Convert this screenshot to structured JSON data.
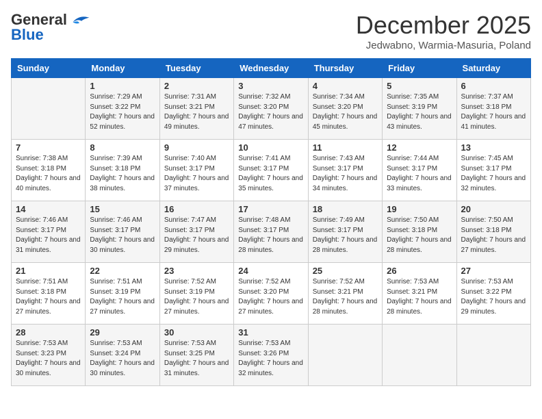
{
  "header": {
    "logo_general": "General",
    "logo_blue": "Blue",
    "month_year": "December 2025",
    "location": "Jedwabno, Warmia-Masuria, Poland"
  },
  "days_of_week": [
    "Sunday",
    "Monday",
    "Tuesday",
    "Wednesday",
    "Thursday",
    "Friday",
    "Saturday"
  ],
  "weeks": [
    [
      {
        "day": "",
        "sunrise": "",
        "sunset": "",
        "daylight": ""
      },
      {
        "day": "1",
        "sunrise": "Sunrise: 7:29 AM",
        "sunset": "Sunset: 3:22 PM",
        "daylight": "Daylight: 7 hours and 52 minutes."
      },
      {
        "day": "2",
        "sunrise": "Sunrise: 7:31 AM",
        "sunset": "Sunset: 3:21 PM",
        "daylight": "Daylight: 7 hours and 49 minutes."
      },
      {
        "day": "3",
        "sunrise": "Sunrise: 7:32 AM",
        "sunset": "Sunset: 3:20 PM",
        "daylight": "Daylight: 7 hours and 47 minutes."
      },
      {
        "day": "4",
        "sunrise": "Sunrise: 7:34 AM",
        "sunset": "Sunset: 3:20 PM",
        "daylight": "Daylight: 7 hours and 45 minutes."
      },
      {
        "day": "5",
        "sunrise": "Sunrise: 7:35 AM",
        "sunset": "Sunset: 3:19 PM",
        "daylight": "Daylight: 7 hours and 43 minutes."
      },
      {
        "day": "6",
        "sunrise": "Sunrise: 7:37 AM",
        "sunset": "Sunset: 3:18 PM",
        "daylight": "Daylight: 7 hours and 41 minutes."
      }
    ],
    [
      {
        "day": "7",
        "sunrise": "Sunrise: 7:38 AM",
        "sunset": "Sunset: 3:18 PM",
        "daylight": "Daylight: 7 hours and 40 minutes."
      },
      {
        "day": "8",
        "sunrise": "Sunrise: 7:39 AM",
        "sunset": "Sunset: 3:18 PM",
        "daylight": "Daylight: 7 hours and 38 minutes."
      },
      {
        "day": "9",
        "sunrise": "Sunrise: 7:40 AM",
        "sunset": "Sunset: 3:17 PM",
        "daylight": "Daylight: 7 hours and 37 minutes."
      },
      {
        "day": "10",
        "sunrise": "Sunrise: 7:41 AM",
        "sunset": "Sunset: 3:17 PM",
        "daylight": "Daylight: 7 hours and 35 minutes."
      },
      {
        "day": "11",
        "sunrise": "Sunrise: 7:43 AM",
        "sunset": "Sunset: 3:17 PM",
        "daylight": "Daylight: 7 hours and 34 minutes."
      },
      {
        "day": "12",
        "sunrise": "Sunrise: 7:44 AM",
        "sunset": "Sunset: 3:17 PM",
        "daylight": "Daylight: 7 hours and 33 minutes."
      },
      {
        "day": "13",
        "sunrise": "Sunrise: 7:45 AM",
        "sunset": "Sunset: 3:17 PM",
        "daylight": "Daylight: 7 hours and 32 minutes."
      }
    ],
    [
      {
        "day": "14",
        "sunrise": "Sunrise: 7:46 AM",
        "sunset": "Sunset: 3:17 PM",
        "daylight": "Daylight: 7 hours and 31 minutes."
      },
      {
        "day": "15",
        "sunrise": "Sunrise: 7:46 AM",
        "sunset": "Sunset: 3:17 PM",
        "daylight": "Daylight: 7 hours and 30 minutes."
      },
      {
        "day": "16",
        "sunrise": "Sunrise: 7:47 AM",
        "sunset": "Sunset: 3:17 PM",
        "daylight": "Daylight: 7 hours and 29 minutes."
      },
      {
        "day": "17",
        "sunrise": "Sunrise: 7:48 AM",
        "sunset": "Sunset: 3:17 PM",
        "daylight": "Daylight: 7 hours and 28 minutes."
      },
      {
        "day": "18",
        "sunrise": "Sunrise: 7:49 AM",
        "sunset": "Sunset: 3:17 PM",
        "daylight": "Daylight: 7 hours and 28 minutes."
      },
      {
        "day": "19",
        "sunrise": "Sunrise: 7:50 AM",
        "sunset": "Sunset: 3:18 PM",
        "daylight": "Daylight: 7 hours and 28 minutes."
      },
      {
        "day": "20",
        "sunrise": "Sunrise: 7:50 AM",
        "sunset": "Sunset: 3:18 PM",
        "daylight": "Daylight: 7 hours and 27 minutes."
      }
    ],
    [
      {
        "day": "21",
        "sunrise": "Sunrise: 7:51 AM",
        "sunset": "Sunset: 3:18 PM",
        "daylight": "Daylight: 7 hours and 27 minutes."
      },
      {
        "day": "22",
        "sunrise": "Sunrise: 7:51 AM",
        "sunset": "Sunset: 3:19 PM",
        "daylight": "Daylight: 7 hours and 27 minutes."
      },
      {
        "day": "23",
        "sunrise": "Sunrise: 7:52 AM",
        "sunset": "Sunset: 3:19 PM",
        "daylight": "Daylight: 7 hours and 27 minutes."
      },
      {
        "day": "24",
        "sunrise": "Sunrise: 7:52 AM",
        "sunset": "Sunset: 3:20 PM",
        "daylight": "Daylight: 7 hours and 27 minutes."
      },
      {
        "day": "25",
        "sunrise": "Sunrise: 7:52 AM",
        "sunset": "Sunset: 3:21 PM",
        "daylight": "Daylight: 7 hours and 28 minutes."
      },
      {
        "day": "26",
        "sunrise": "Sunrise: 7:53 AM",
        "sunset": "Sunset: 3:21 PM",
        "daylight": "Daylight: 7 hours and 28 minutes."
      },
      {
        "day": "27",
        "sunrise": "Sunrise: 7:53 AM",
        "sunset": "Sunset: 3:22 PM",
        "daylight": "Daylight: 7 hours and 29 minutes."
      }
    ],
    [
      {
        "day": "28",
        "sunrise": "Sunrise: 7:53 AM",
        "sunset": "Sunset: 3:23 PM",
        "daylight": "Daylight: 7 hours and 30 minutes."
      },
      {
        "day": "29",
        "sunrise": "Sunrise: 7:53 AM",
        "sunset": "Sunset: 3:24 PM",
        "daylight": "Daylight: 7 hours and 30 minutes."
      },
      {
        "day": "30",
        "sunrise": "Sunrise: 7:53 AM",
        "sunset": "Sunset: 3:25 PM",
        "daylight": "Daylight: 7 hours and 31 minutes."
      },
      {
        "day": "31",
        "sunrise": "Sunrise: 7:53 AM",
        "sunset": "Sunset: 3:26 PM",
        "daylight": "Daylight: 7 hours and 32 minutes."
      },
      {
        "day": "",
        "sunrise": "",
        "sunset": "",
        "daylight": ""
      },
      {
        "day": "",
        "sunrise": "",
        "sunset": "",
        "daylight": ""
      },
      {
        "day": "",
        "sunrise": "",
        "sunset": "",
        "daylight": ""
      }
    ]
  ]
}
